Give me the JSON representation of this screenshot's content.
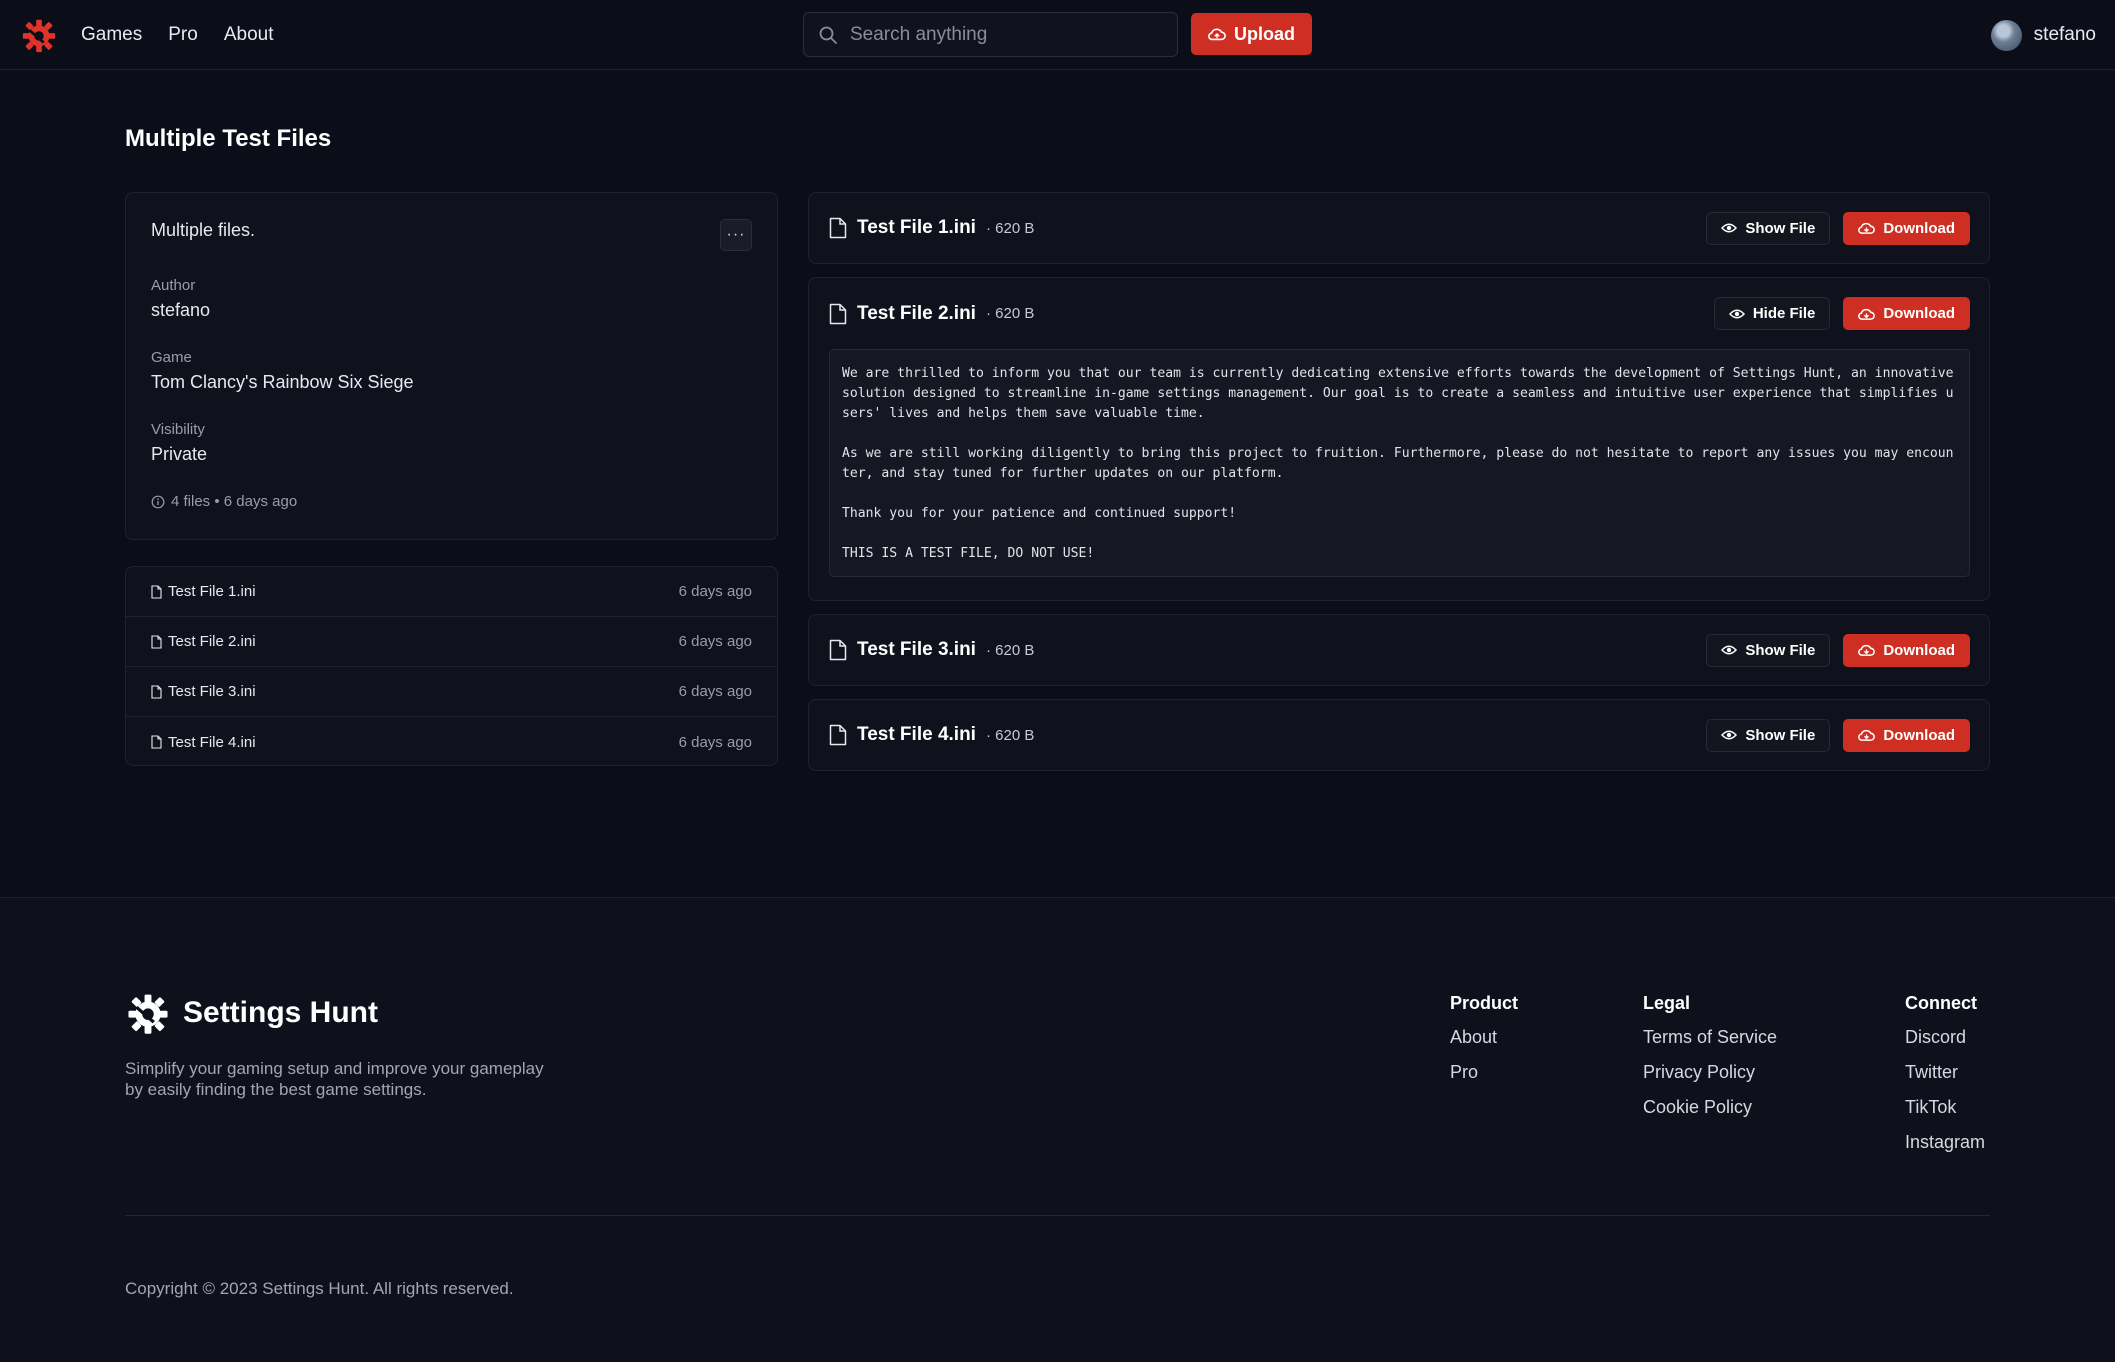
{
  "header": {
    "nav": [
      "Games",
      "Pro",
      "About"
    ],
    "search_placeholder": "Search anything",
    "upload_label": "Upload",
    "user_name": "stefano"
  },
  "page": {
    "title": "Multiple Test Files",
    "description": "Multiple files.",
    "more_label": "···",
    "fields": {
      "author_label": "Author",
      "author": "stefano",
      "game_label": "Game",
      "game": "Tom Clancy's Rainbow Six Siege",
      "visibility_label": "Visibility",
      "visibility": "Private"
    },
    "meta": "4 files • 6 days ago"
  },
  "files_list": [
    {
      "name": "Test File 1.ini",
      "date": "6 days ago"
    },
    {
      "name": "Test File 2.ini",
      "date": "6 days ago"
    },
    {
      "name": "Test File 3.ini",
      "date": "6 days ago"
    },
    {
      "name": "Test File 4.ini",
      "date": "6 days ago"
    }
  ],
  "file_cards": [
    {
      "name": "Test File 1.ini",
      "size": "· 620 B",
      "toggle_label": "Show File",
      "download_label": "Download"
    },
    {
      "name": "Test File 2.ini",
      "size": "· 620 B",
      "toggle_label": "Hide File",
      "download_label": "Download",
      "content": "We are thrilled to inform you that our team is currently dedicating extensive efforts towards the development of Settings Hunt, an innovative solution designed to streamline in-game settings management. Our goal is to create a seamless and intuitive user experience that simplifies users' lives and helps them save valuable time.\n\nAs we are still working diligently to bring this project to fruition. Furthermore, please do not hesitate to report any issues you may encounter, and stay tuned for further updates on our platform.\n\nThank you for your patience and continued support!\n\nTHIS IS A TEST FILE, DO NOT USE!"
    },
    {
      "name": "Test File 3.ini",
      "size": "· 620 B",
      "toggle_label": "Show File",
      "download_label": "Download"
    },
    {
      "name": "Test File 4.ini",
      "size": "· 620 B",
      "toggle_label": "Show File",
      "download_label": "Download"
    }
  ],
  "footer": {
    "brand": "Settings Hunt",
    "tagline": "Simplify your gaming setup and improve your gameplay by easily finding the best game settings.",
    "columns": [
      {
        "title": "Product",
        "links": [
          "About",
          "Pro"
        ]
      },
      {
        "title": "Legal",
        "links": [
          "Terms of Service",
          "Privacy Policy",
          "Cookie Policy"
        ]
      },
      {
        "title": "Connect",
        "links": [
          "Discord",
          "Twitter",
          "TikTok",
          "Instagram"
        ]
      }
    ],
    "copyright": "Copyright © 2023 Settings Hunt. All rights reserved."
  },
  "colors": {
    "accent": "#cf2e23",
    "background": "#0b0d18",
    "footer_bg": "#0e101c"
  }
}
